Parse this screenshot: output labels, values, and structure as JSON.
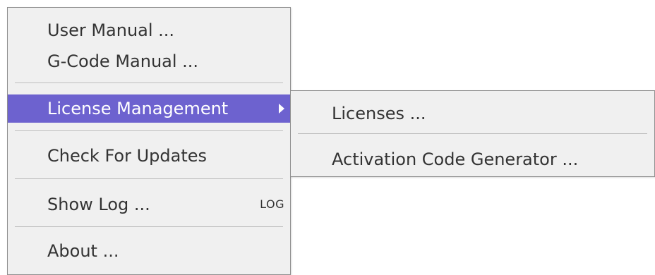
{
  "menu": {
    "items": [
      {
        "label": "User Manual ..."
      },
      {
        "label": "G-Code Manual ..."
      },
      {
        "label": "License Management"
      },
      {
        "label": "Check For Updates"
      },
      {
        "label": "Show Log ...",
        "shortcut": "LOG"
      },
      {
        "label": "About ..."
      }
    ],
    "active_color": "#6d62cf"
  },
  "submenu": {
    "items": [
      {
        "label": "Licenses ..."
      },
      {
        "label": "Activation Code Generator ..."
      }
    ]
  },
  "icons": {
    "submenu_arrow": "triangle-right-icon"
  }
}
